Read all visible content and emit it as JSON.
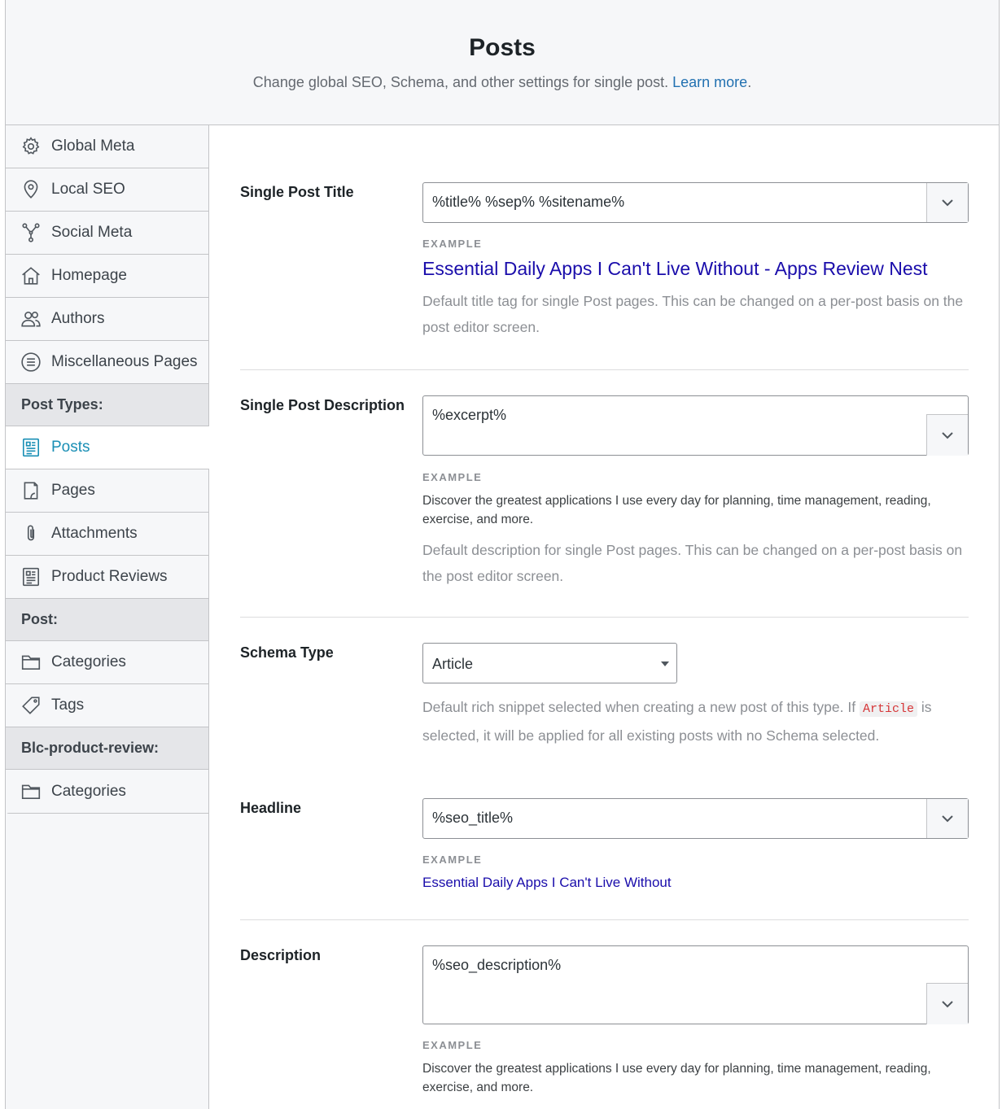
{
  "header": {
    "title": "Posts",
    "subtitle": "Change global SEO, Schema, and other settings for single post.",
    "learn_more": "Learn more",
    "period": "."
  },
  "sidebar": {
    "items": [
      {
        "label": "Global Meta",
        "icon": "gear-icon"
      },
      {
        "label": "Local SEO",
        "icon": "location-pin-icon"
      },
      {
        "label": "Social Meta",
        "icon": "share-network-icon"
      },
      {
        "label": "Homepage",
        "icon": "home-icon"
      },
      {
        "label": "Authors",
        "icon": "users-icon"
      },
      {
        "label": "Miscellaneous Pages",
        "icon": "list-circle-icon"
      }
    ],
    "group_post_types": "Post Types:",
    "post_types": [
      {
        "label": "Posts",
        "icon": "post-document-icon",
        "active": true
      },
      {
        "label": "Pages",
        "icon": "page-icon"
      },
      {
        "label": "Attachments",
        "icon": "paperclip-icon"
      },
      {
        "label": "Product Reviews",
        "icon": "review-document-icon"
      }
    ],
    "group_post": "Post:",
    "post_tax": [
      {
        "label": "Categories",
        "icon": "folder-icon"
      },
      {
        "label": "Tags",
        "icon": "tag-icon"
      }
    ],
    "group_blc": "Blc-product-review:",
    "blc_tax": [
      {
        "label": "Categories",
        "icon": "folder-icon"
      }
    ]
  },
  "fields": {
    "title": {
      "label": "Single Post Title",
      "value": "%title% %sep% %sitename%",
      "example_label": "EXAMPLE",
      "example": "Essential Daily Apps I Can't Live Without - Apps Review Nest",
      "help": "Default title tag for single Post pages. This can be changed on a per-post basis on the post editor screen."
    },
    "description": {
      "label": "Single Post Description",
      "value": "%excerpt%",
      "example_label": "EXAMPLE",
      "example": "Discover the greatest applications I use every day for planning, time management, reading, exercise, and more.",
      "help": "Default description for single Post pages. This can be changed on a per-post basis on the post editor screen."
    },
    "schema": {
      "label": "Schema Type",
      "value": "Article",
      "help_before": "Default rich snippet selected when creating a new post of this type. If",
      "help_code": "Article",
      "help_after": "is selected, it will be applied for all existing posts with no Schema selected."
    },
    "headline": {
      "label": "Headline",
      "value": "%seo_title%",
      "example_label": "EXAMPLE",
      "example": "Essential Daily Apps I Can't Live Without"
    },
    "desc2": {
      "label": "Description",
      "value": "%seo_description%",
      "example_label": "EXAMPLE",
      "example": "Discover the greatest applications I use every day for planning, time management, reading, exercise, and more."
    }
  },
  "colors": {
    "accent": "#1a8fb5",
    "link": "#2271b1",
    "serp_title": "#1a0dab"
  }
}
